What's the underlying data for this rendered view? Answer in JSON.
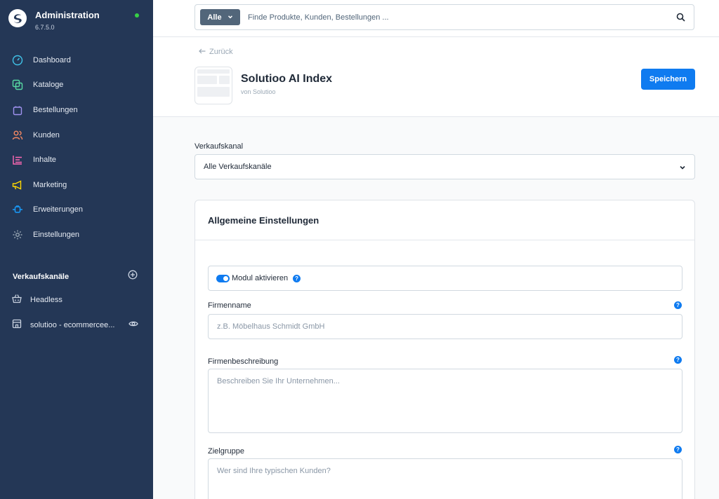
{
  "app": {
    "title": "Administration",
    "version": "6.7.5.0",
    "accent": "#0f7bf0",
    "sidebar_bg": "#243756"
  },
  "nav": [
    {
      "label": "Dashboard",
      "icon": "dashboard-icon",
      "color": "#40c3e8"
    },
    {
      "label": "Kataloge",
      "icon": "catalog-icon",
      "color": "#57d9a3"
    },
    {
      "label": "Bestellungen",
      "icon": "shopping-bag-icon",
      "color": "#a092f0"
    },
    {
      "label": "Kunden",
      "icon": "customers-icon",
      "color": "#f88962"
    },
    {
      "label": "Inhalte",
      "icon": "content-icon",
      "color": "#ff68b4"
    },
    {
      "label": "Marketing",
      "icon": "megaphone-icon",
      "color": "#ffd700"
    },
    {
      "label": "Erweiterungen",
      "icon": "plug-icon",
      "color": "#189eff"
    },
    {
      "label": "Einstellungen",
      "icon": "gear-icon",
      "color": "#9aa8b5"
    }
  ],
  "sales_channels": {
    "title": "Verkaufskanäle",
    "items": [
      {
        "label": "Headless",
        "icon": "basket-icon"
      },
      {
        "label": "solutioo - ecommercee...",
        "icon": "storefront-icon"
      }
    ]
  },
  "search": {
    "type_label": "Alle",
    "placeholder": "Finde Produkte, Kunden, Bestellungen ..."
  },
  "header": {
    "back_label": "Zurück",
    "title": "Solutioo AI Index",
    "subtitle": "von Solutioo",
    "save_label": "Speichern"
  },
  "form": {
    "sales_channel_label": "Verkaufskanal",
    "sales_channel_value": "Alle Verkaufskanäle",
    "card_title": "Allgemeine Einstellungen",
    "toggle_label": "Modul aktivieren",
    "toggle_on": true,
    "company_name_label": "Firmenname",
    "company_name_placeholder": "z.B. Möbelhaus Schmidt GmbH",
    "company_desc_label": "Firmenbeschreibung",
    "company_desc_placeholder": "Beschreiben Sie Ihr Unternehmen...",
    "audience_label": "Zielgruppe",
    "audience_placeholder": "Wer sind Ihre typischen Kunden?",
    "help_glyph": "?"
  }
}
